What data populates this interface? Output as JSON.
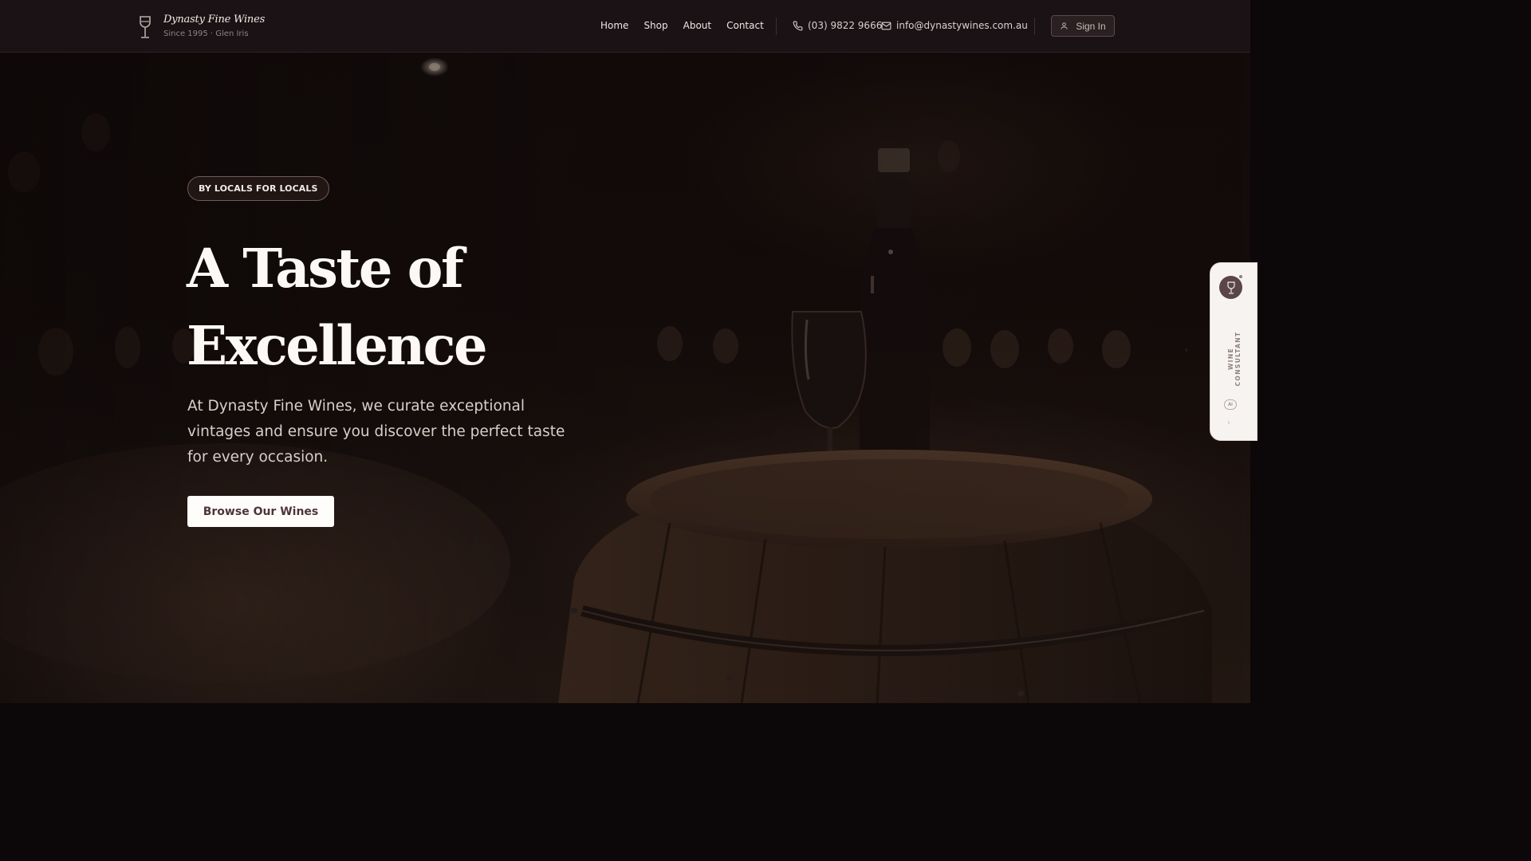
{
  "brand": {
    "name": "Dynasty Fine Wines",
    "tagline": "Since 1995 · Glen Iris",
    "icon": "wine-glass-icon"
  },
  "nav": {
    "items": [
      {
        "label": "Home"
      },
      {
        "label": "Shop"
      },
      {
        "label": "About"
      },
      {
        "label": "Contact"
      }
    ]
  },
  "contact": {
    "phone": "(03) 9822 9666",
    "phone_icon": "phone-icon",
    "email": "info@dynastywines.com.au",
    "email_icon": "mail-icon"
  },
  "auth": {
    "sign_in_label": "Sign In",
    "icon": "user-icon"
  },
  "hero": {
    "badge": "BY LOCALS FOR LOCALS",
    "headline_line1": "A Taste of",
    "headline_line2": "Excellence",
    "lede": "At Dynasty Fine Wines, we curate exceptional vintages and ensure you discover the perfect taste for every occasion.",
    "cta_label": "Browse Our Wines"
  },
  "widget": {
    "label": "WINE CONSULTANT",
    "badge": "AI",
    "icon": "wine-glass-icon"
  },
  "colors": {
    "header_bg": "#1b1215",
    "hero_bg": "#140c0a",
    "cta_text": "#4d3538",
    "widget_bg": "#f7f3f1"
  }
}
